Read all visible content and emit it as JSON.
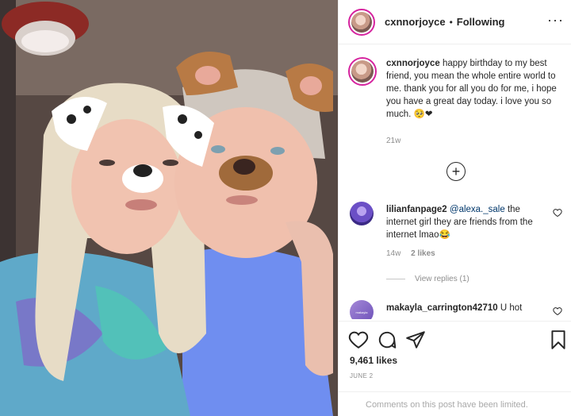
{
  "post": {
    "username": "cxnnorjoyce",
    "separator": "•",
    "follow_status": "Following",
    "more_glyph": "···",
    "caption_user": "cxnnorjoyce",
    "caption_text": " happy birthday to my best friend, you mean the whole entire world to me. thank you for all you do for me, i hope you have a great day today. i love you so much. 🥺❤",
    "caption_time": "21w",
    "load_more_glyph": "+"
  },
  "comments": [
    {
      "username": "lilianfanpage2",
      "mention": "@alexa._sale",
      "text": " the internet girl they are friends from the internet lmao😂",
      "time": "14w",
      "likes": "2 likes"
    },
    {
      "username": "makayla_carrington42710",
      "text": " U hot",
      "avatar_text": "makayla"
    }
  ],
  "view_replies": "View replies (1)",
  "likes_count": "9,461 likes",
  "post_date": "JUNE 2",
  "comments_limited": "Comments on this post have been limited.",
  "icons": {
    "like": "heart-icon",
    "comment": "comment-icon",
    "share": "share-icon",
    "save": "bookmark-icon",
    "more": "more-icon",
    "load_more": "plus-circle-icon"
  },
  "colors": {
    "text": "#262626",
    "secondary": "#8e8e8e",
    "mention": "#00376b",
    "story_ring": "#d6249f"
  }
}
